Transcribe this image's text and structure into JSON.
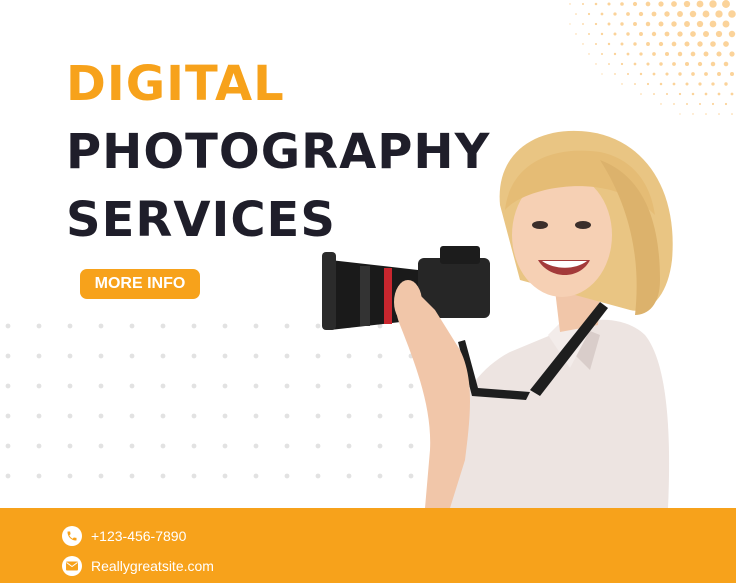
{
  "colors": {
    "accent": "#f7a21b",
    "title_dark": "#1f1e2a",
    "dots": "#e2e2e2",
    "halftone": "#fbd39a"
  },
  "title": {
    "line1": "DIGITAL",
    "line2": "PHOTOGRAPHY",
    "line3": "SERVICES"
  },
  "cta": {
    "label": "MORE INFO"
  },
  "contact": {
    "phone": "+123-456-7890",
    "website": "Reallygreatsite.com",
    "phone_icon": "phone-icon",
    "email_icon": "envelope-icon"
  },
  "photo": {
    "subject": "photographer-with-camera"
  }
}
